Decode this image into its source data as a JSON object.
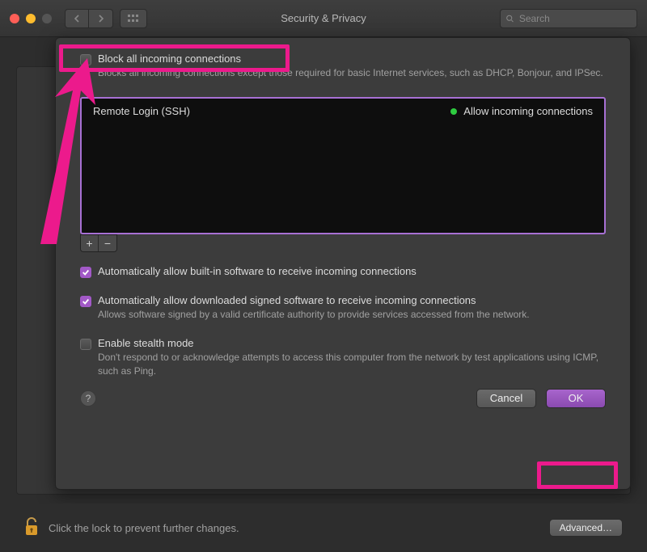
{
  "window": {
    "title": "Security & Privacy",
    "search_placeholder": "Search"
  },
  "sheet": {
    "block_all": {
      "label": "Block all incoming connections",
      "description": "Blocks all incoming connections except those required for basic Internet services, such as DHCP, Bonjour, and IPSec.",
      "checked": false
    },
    "list": {
      "items": [
        {
          "name": "Remote Login (SSH)",
          "status": "Allow incoming connections"
        }
      ]
    },
    "add_label": "+",
    "remove_label": "−",
    "auto_builtin": {
      "label": "Automatically allow built-in software to receive incoming connections",
      "checked": true
    },
    "auto_signed": {
      "label": "Automatically allow downloaded signed software to receive incoming connections",
      "description": "Allows software signed by a valid certificate authority to provide services accessed from the network.",
      "checked": true
    },
    "stealth": {
      "label": "Enable stealth mode",
      "description": "Don't respond to or acknowledge attempts to access this computer from the network by test applications using ICMP, such as Ping.",
      "checked": false
    },
    "help_label": "?",
    "cancel_label": "Cancel",
    "ok_label": "OK"
  },
  "bottom": {
    "lock_text": "Click the lock to prevent further changes.",
    "advanced_label": "Advanced…"
  },
  "annotations": {
    "highlight_color": "#ec1a8c",
    "list_border_color": "#a770d4"
  }
}
